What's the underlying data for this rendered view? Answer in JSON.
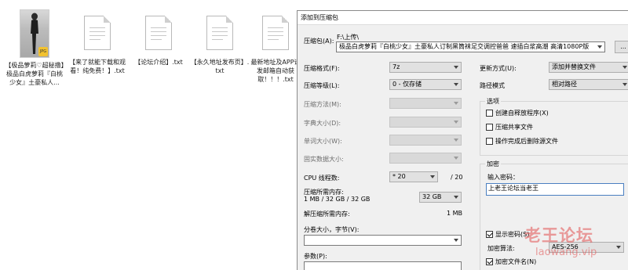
{
  "files": [
    {
      "name": "【极品萝莉♡超秘撸】极品白虎萝莉『白桃少女』土豪私人...",
      "type": "image",
      "badge": "JPG"
    },
    {
      "name": "【来了就能下载和观看！纯免费！】.txt",
      "type": "text"
    },
    {
      "name": "【论坛介绍】.txt",
      "type": "text"
    },
    {
      "name": "【永久地址发布页】.txt",
      "type": "text"
    },
    {
      "name": "最新地址及APP请发邮箱自动获取！！！.txt",
      "type": "text"
    }
  ],
  "dialog": {
    "title": "添加到压缩包",
    "archive_label": "压缩包(A):",
    "archive_dir": "F:\\上传\\",
    "archive_name": "极品白虎萝莉『白桃少女』土豪私人订制黑筒袜足交调控爸爸 速插白浆高潮 高清1080P版",
    "browse_label": "...",
    "format_label": "压缩格式(F):",
    "format_value": "7z",
    "level_label": "压缩等级(L):",
    "level_value": "0 - 仅存储",
    "method_label": "压缩方法(M):",
    "dict_label": "字典大小(D):",
    "word_label": "单词大小(W):",
    "solid_label": "固实数据大小:",
    "threads_label": "CPU 线程数:",
    "threads_value": "* 20",
    "threads_max": "/ 20",
    "mem_label": "压缩所需内存:",
    "mem_detail": "1 MB / 32 GB / 32 GB",
    "mem_value": "32 GB",
    "decomp_label": "解压缩所需内存:",
    "decomp_value": "1 MB",
    "split_label": "分卷大小，字节(V):",
    "split_value": "",
    "params_label": "参数(P):",
    "update_label": "更新方式(U):",
    "update_value": "添加并替换文件",
    "path_label": "路径模式",
    "path_value": "相对路径",
    "options_group": "选项",
    "opt_sfx": "创建自释放程序(X)",
    "opt_shared": "压缩共享文件",
    "opt_delete": "操作完成后删除源文件",
    "encrypt_group": "加密",
    "password_label": "输入密码：",
    "password_value": "上老王论坛当老王",
    "show_password": "显示密码(S)",
    "enc_method_label": "加密算法:",
    "enc_method_value": "AES-256",
    "encrypt_names": "加密文件名(N)"
  },
  "watermark": {
    "line1": "老王论坛",
    "line2": "laowang.vip"
  },
  "colors": {
    "dialog_bg": "#f0f0f0",
    "watermark": "#e15050"
  }
}
